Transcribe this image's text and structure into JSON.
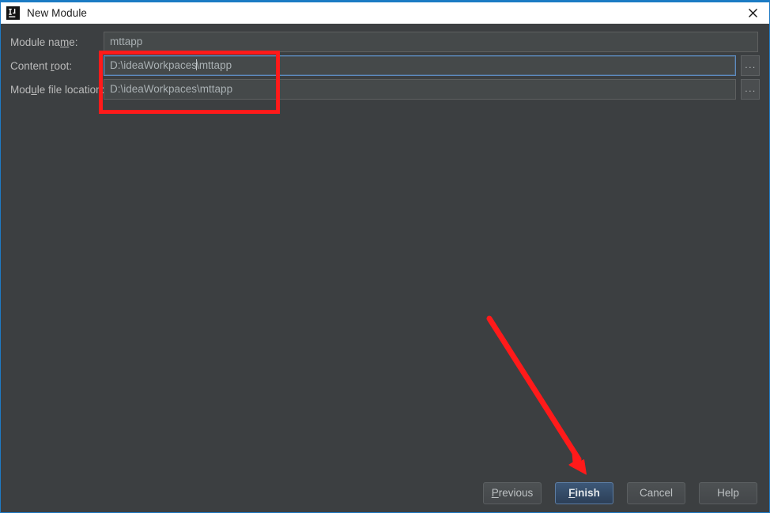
{
  "window": {
    "title": "New Module",
    "icon": "intellij-idea-icon",
    "close_label": "✕",
    "accent_color": "#1b7bc4",
    "titlebar_bg": "#ffffff",
    "body_bg": "#3c3f41"
  },
  "form": {
    "rows": [
      {
        "label_before": "Module na",
        "label_mnemonic": "m",
        "label_after": "e:",
        "value": "mttapp",
        "placeholder": "Module name",
        "focused": false,
        "has_browse": false
      },
      {
        "label_before": "Content ",
        "label_mnemonic": "r",
        "label_after": "oot:",
        "value_before_caret": "D:\\ideaWorkpaces",
        "value_after_caret": "\\mttapp",
        "value": "D:\\ideaWorkpaces\\mttapp",
        "placeholder": "Content root",
        "focused": true,
        "has_browse": true,
        "browse_label": "..."
      },
      {
        "label_before": "Mod",
        "label_mnemonic": "u",
        "label_after": "le file location:",
        "value": "D:\\ideaWorkpaces\\mttapp",
        "placeholder": "Module file location",
        "focused": false,
        "has_browse": true,
        "browse_label": "..."
      }
    ]
  },
  "buttons": {
    "previous": {
      "before": "",
      "mnemonic": "P",
      "after": "revious"
    },
    "finish": {
      "before": "",
      "mnemonic": "F",
      "after": "inish"
    },
    "cancel": {
      "label": "Cancel"
    },
    "help": {
      "label": "Help"
    }
  },
  "annotations": {
    "highlight_color": "#ff1a1a",
    "rectangle_target": "content-root-and-module-file-location-fields",
    "arrow_target": "finish-button"
  }
}
